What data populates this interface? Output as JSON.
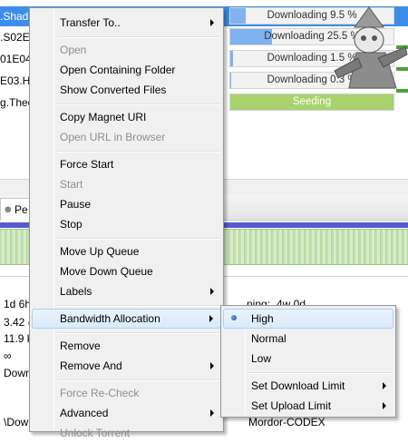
{
  "torrent_list": {
    "rows": [
      {
        "name": ".Shad",
        "status": "Downloading 9.5 %",
        "progress": 0.095,
        "selected": true
      },
      {
        "name": ".S02E0",
        "status": "Downloading 25.5 %",
        "progress": 0.255,
        "selected": false
      },
      {
        "name": "01E04.",
        "status": "Downloading 1.5 %",
        "progress": 0.015,
        "selected": false
      },
      {
        "name": "E03.H",
        "status": "Downloading 0.3 %",
        "progress": 0.003,
        "selected": false
      },
      {
        "name": "g.Theo",
        "status": "Seeding",
        "progress": 1.0,
        "selected": false
      }
    ]
  },
  "details": {
    "tab_peers": "Pe",
    "left_values": [
      "1d 6h",
      "3.42 (",
      "11.9 k",
      "∞",
      "Down",
      "",
      "\\Dow"
    ],
    "remaining_label": "ning:",
    "remaining_value": "4w 0d",
    "bottom_right_text": "Mordor-CODEX"
  },
  "context_menu": {
    "items": {
      "transfer_to": "Transfer To..",
      "open": "Open",
      "open_containing_folder": "Open Containing Folder",
      "show_converted_files": "Show Converted Files",
      "copy_magnet_uri": "Copy Magnet URI",
      "open_url_in_browser": "Open URL in Browser",
      "force_start": "Force Start",
      "start": "Start",
      "pause": "Pause",
      "stop": "Stop",
      "move_up_queue": "Move Up Queue",
      "move_down_queue": "Move Down Queue",
      "labels": "Labels",
      "bandwidth_allocation": "Bandwidth Allocation",
      "remove": "Remove",
      "remove_and": "Remove And",
      "force_recheck": "Force Re-Check",
      "advanced": "Advanced",
      "unlock_torrent": "Unlock Torrent"
    }
  },
  "bandwidth_submenu": {
    "high": "High",
    "normal": "Normal",
    "low": "Low",
    "set_download_limit": "Set Download Limit",
    "set_upload_limit": "Set Upload Limit",
    "selected": "High"
  },
  "colors": {
    "selection_blue": "#3d8ee8",
    "seeding_green": "#a9d26e",
    "menu_highlight": "#d9eaf9"
  }
}
